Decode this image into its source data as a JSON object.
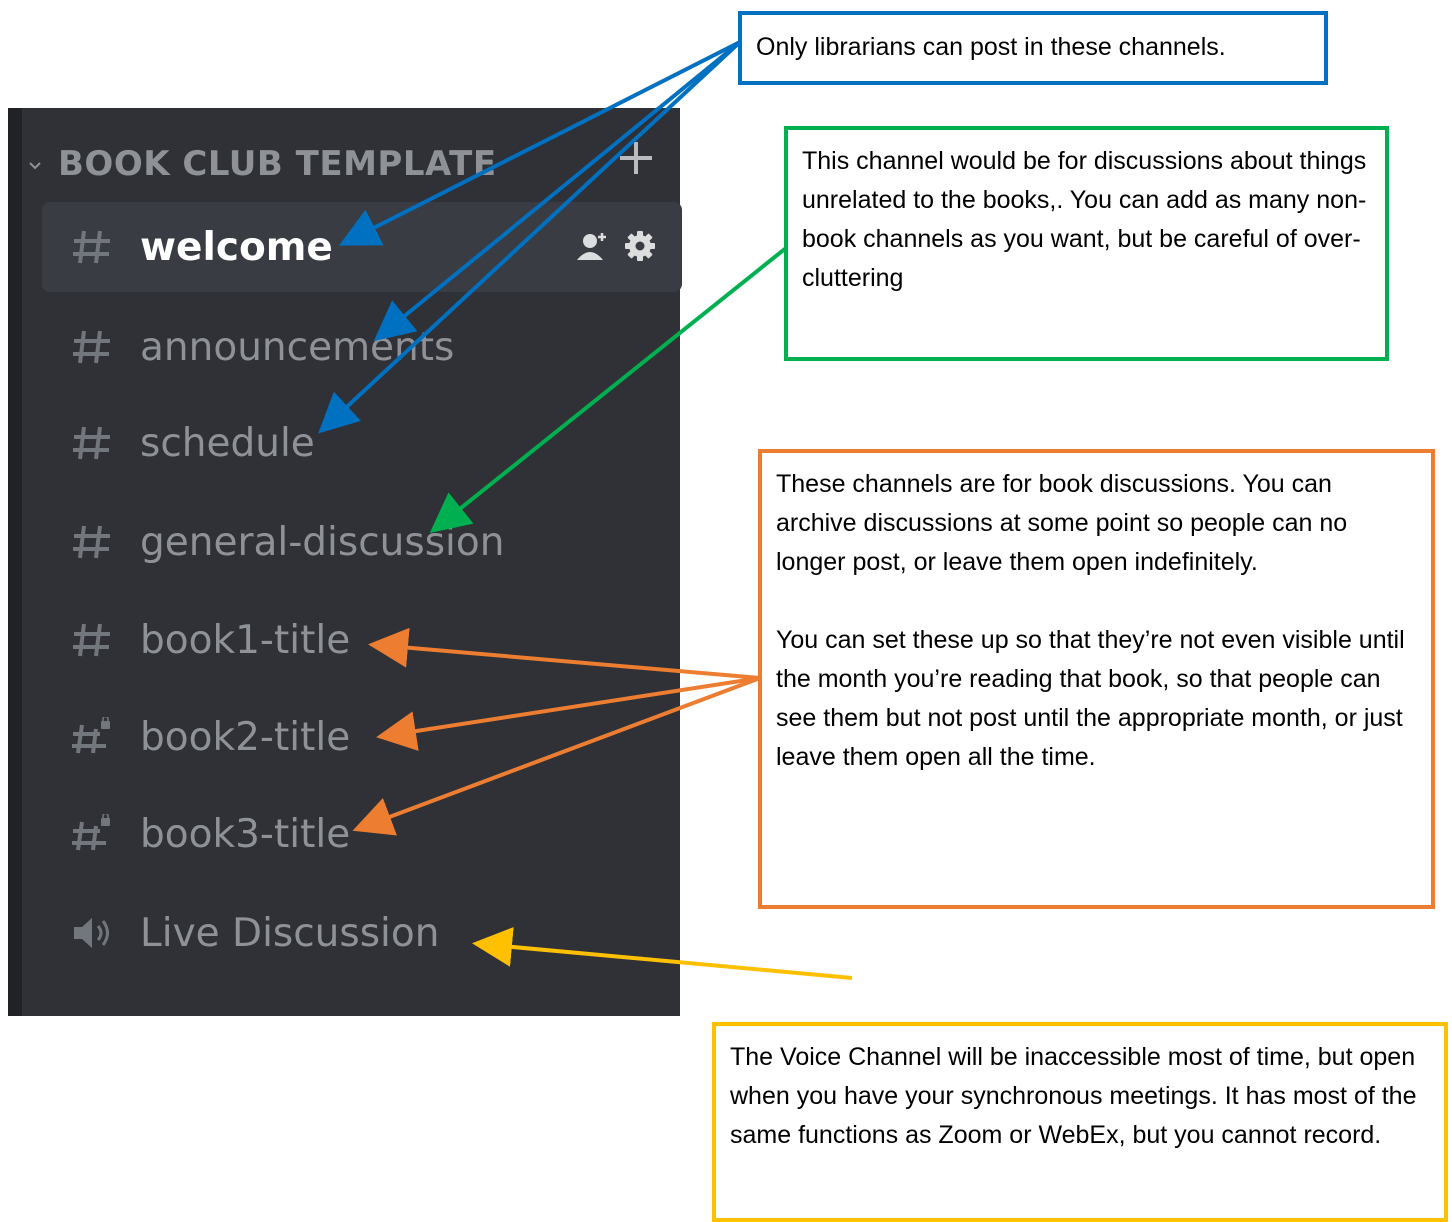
{
  "sidebar": {
    "category": "BOOK CLUB TEMPLATE",
    "channels": [
      {
        "label": "welcome",
        "icon": "hash-icon",
        "active": true
      },
      {
        "label": "announcements",
        "icon": "hash-icon"
      },
      {
        "label": "schedule",
        "icon": "hash-icon"
      },
      {
        "label": "general-discussion",
        "icon": "hash-icon"
      },
      {
        "label": "book1-title",
        "icon": "hash-icon"
      },
      {
        "label": "book2-title",
        "icon": "locked-hash-icon"
      },
      {
        "label": "book3-title",
        "icon": "locked-hash-icon"
      },
      {
        "label": "Live Discussion",
        "icon": "speaker-icon"
      }
    ]
  },
  "annotations": {
    "blue": "Only librarians can post in these channels.",
    "green": "This channel would be for discussions about things unrelated to the books,.  You can add as many non-book channels as you want, but be careful of over-cluttering",
    "orange_p1": "These channels are for book discussions.  You can archive discussions  at some point  so people can no longer post, or leave them open indefinitely.",
    "orange_p2": "You can set these up so that they’re not even visible until the month you’re reading that book, so that people can see them but not post until the  appropriate month, or just leave them open all the time.",
    "yellow": "The Voice Channel will be inaccessible most of time, but open when you have your synchronous meetings.  It has most of the same functions as Zoom or WebEx, but you cannot record."
  },
  "colors": {
    "sidebar_bg": "#2f3136",
    "active_bg": "#393c43",
    "muted_text": "#8e9297",
    "blue": "#0070c0",
    "green": "#00b050",
    "orange": "#ed7d31",
    "yellow": "#ffc000"
  }
}
